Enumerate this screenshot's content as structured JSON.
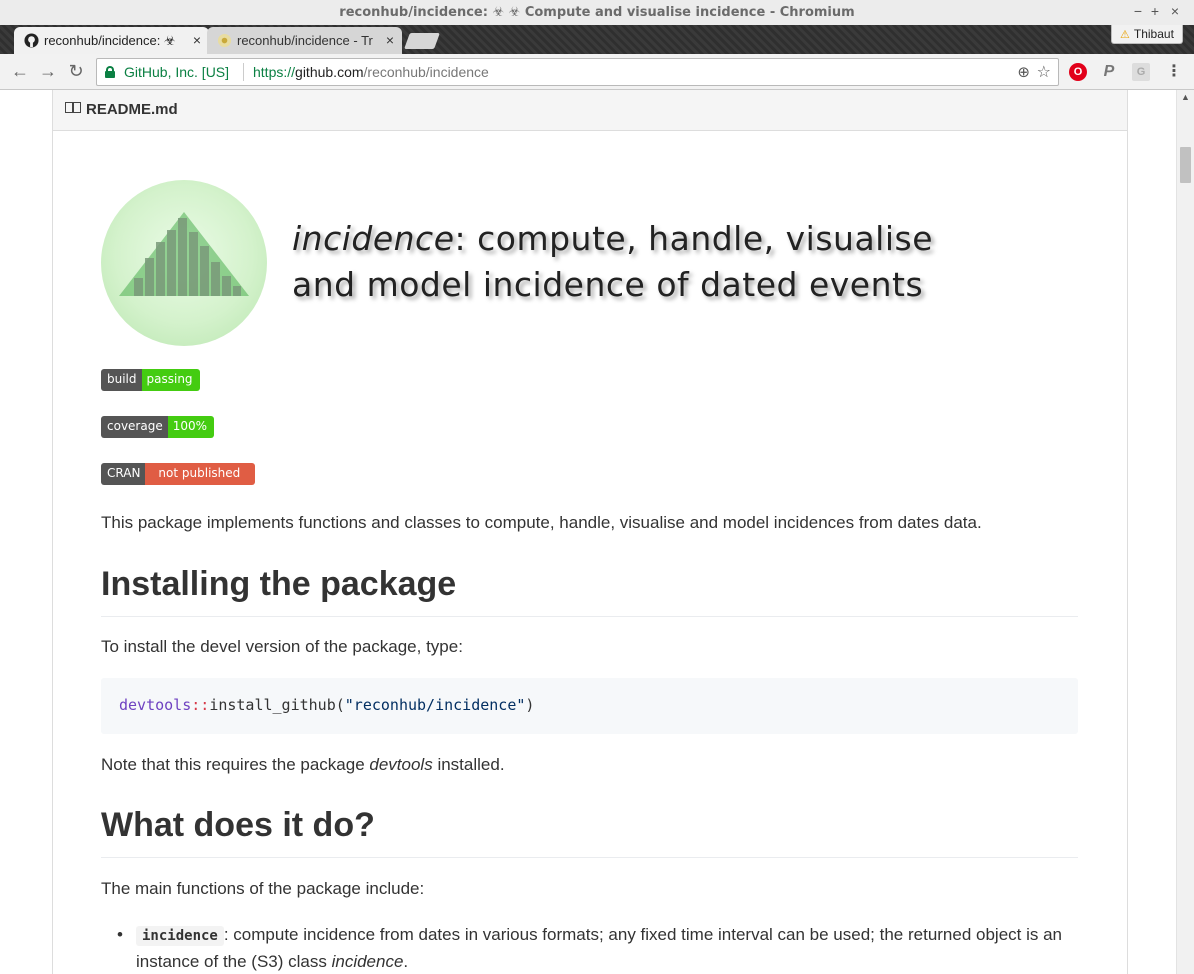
{
  "window": {
    "title": "reconhub/incidence: ☣ ☣ Compute and visualise incidence - Chromium",
    "controls": [
      "−",
      "+",
      "×"
    ]
  },
  "tabs": [
    {
      "label": "reconhub/incidence: ☣",
      "close": "×"
    },
    {
      "label": "reconhub/incidence - Tr",
      "close": "×"
    }
  ],
  "profile": {
    "warning": "⚠",
    "name": "Thibaut"
  },
  "toolbar": {
    "back": "←",
    "forward": "→",
    "reload": "↻",
    "site_identity": "GitHub, Inc. [US]",
    "url_scheme": "https://",
    "url_host": "github.com",
    "url_path": "/reconhub/incidence",
    "zoom_icon": "⊕",
    "bookmark_icon": "☆",
    "ext_opera": "O",
    "ext_p": "P",
    "ext_gray": "G",
    "menu": "⋮"
  },
  "readme": {
    "filename": "README.md",
    "logo_line1_italic": "incidence",
    "logo_line1_rest": ": compute, handle, visualise",
    "logo_line2": "and model incidence of dated events",
    "badges": [
      {
        "left": "build",
        "right": "passing",
        "color": "#44cc11"
      },
      {
        "left": "coverage",
        "right": "100%",
        "color": "#44cc11"
      },
      {
        "left": "CRAN",
        "right": "not published",
        "color": "#e05d44"
      }
    ],
    "intro": "This package implements functions and classes to compute, handle, visualise and model incidences from dates data.",
    "h_install": "Installing the package",
    "install_text": "To install the devel version of the package, type:",
    "code_ns": "devtools",
    "code_op": "::",
    "code_fn": "install_github(",
    "code_str": "\"reconhub/incidence\"",
    "code_close": ")",
    "note_pre": "Note that this requires the package ",
    "note_em": "devtools",
    "note_post": " installed.",
    "h_what": "What does it do?",
    "main_funcs": "The main functions of the package include:",
    "bullet1_code": "incidence",
    "bullet1_text": ": compute incidence from dates in various formats; any fixed time interval can be used; the returned object is an instance of the (S3) class ",
    "bullet1_em": "incidence",
    "bullet1_end": "."
  }
}
